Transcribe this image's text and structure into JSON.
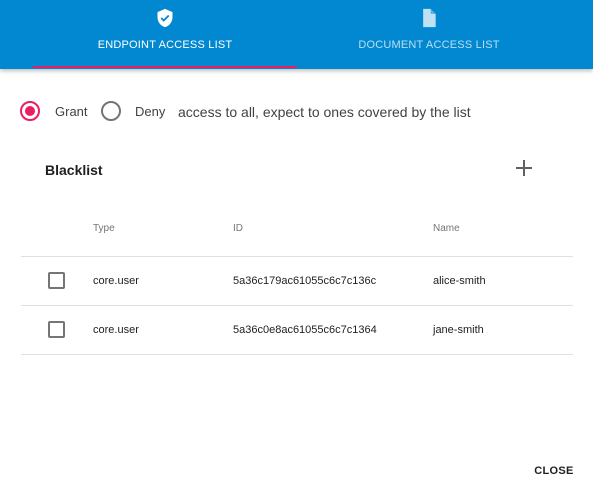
{
  "tabs": [
    {
      "label": "ENDPOINT ACCESS LIST",
      "icon": "shield-check-icon",
      "active": true
    },
    {
      "label": "DOCUMENT ACCESS LIST",
      "icon": "document-icon",
      "active": false
    }
  ],
  "access_mode": {
    "options": [
      {
        "label": "Grant",
        "selected": true
      },
      {
        "label": "Deny",
        "selected": false
      }
    ],
    "description": "access to all, expect to ones covered by the list"
  },
  "list": {
    "title": "Blacklist",
    "add_icon": "plus-icon",
    "columns": [
      "Type",
      "ID",
      "Name"
    ],
    "rows": [
      {
        "type": "core.user",
        "id": "5a36c179ac61055c6c7c136c",
        "name": "alice-smith",
        "checked": false
      },
      {
        "type": "core.user",
        "id": "5a36c0e8ac61055c6c7c1364",
        "name": "jane-smith",
        "checked": false
      }
    ]
  },
  "footer": {
    "close_label": "CLOSE"
  },
  "colors": {
    "appbar": "#0288d1",
    "accent": "#e91e63"
  }
}
